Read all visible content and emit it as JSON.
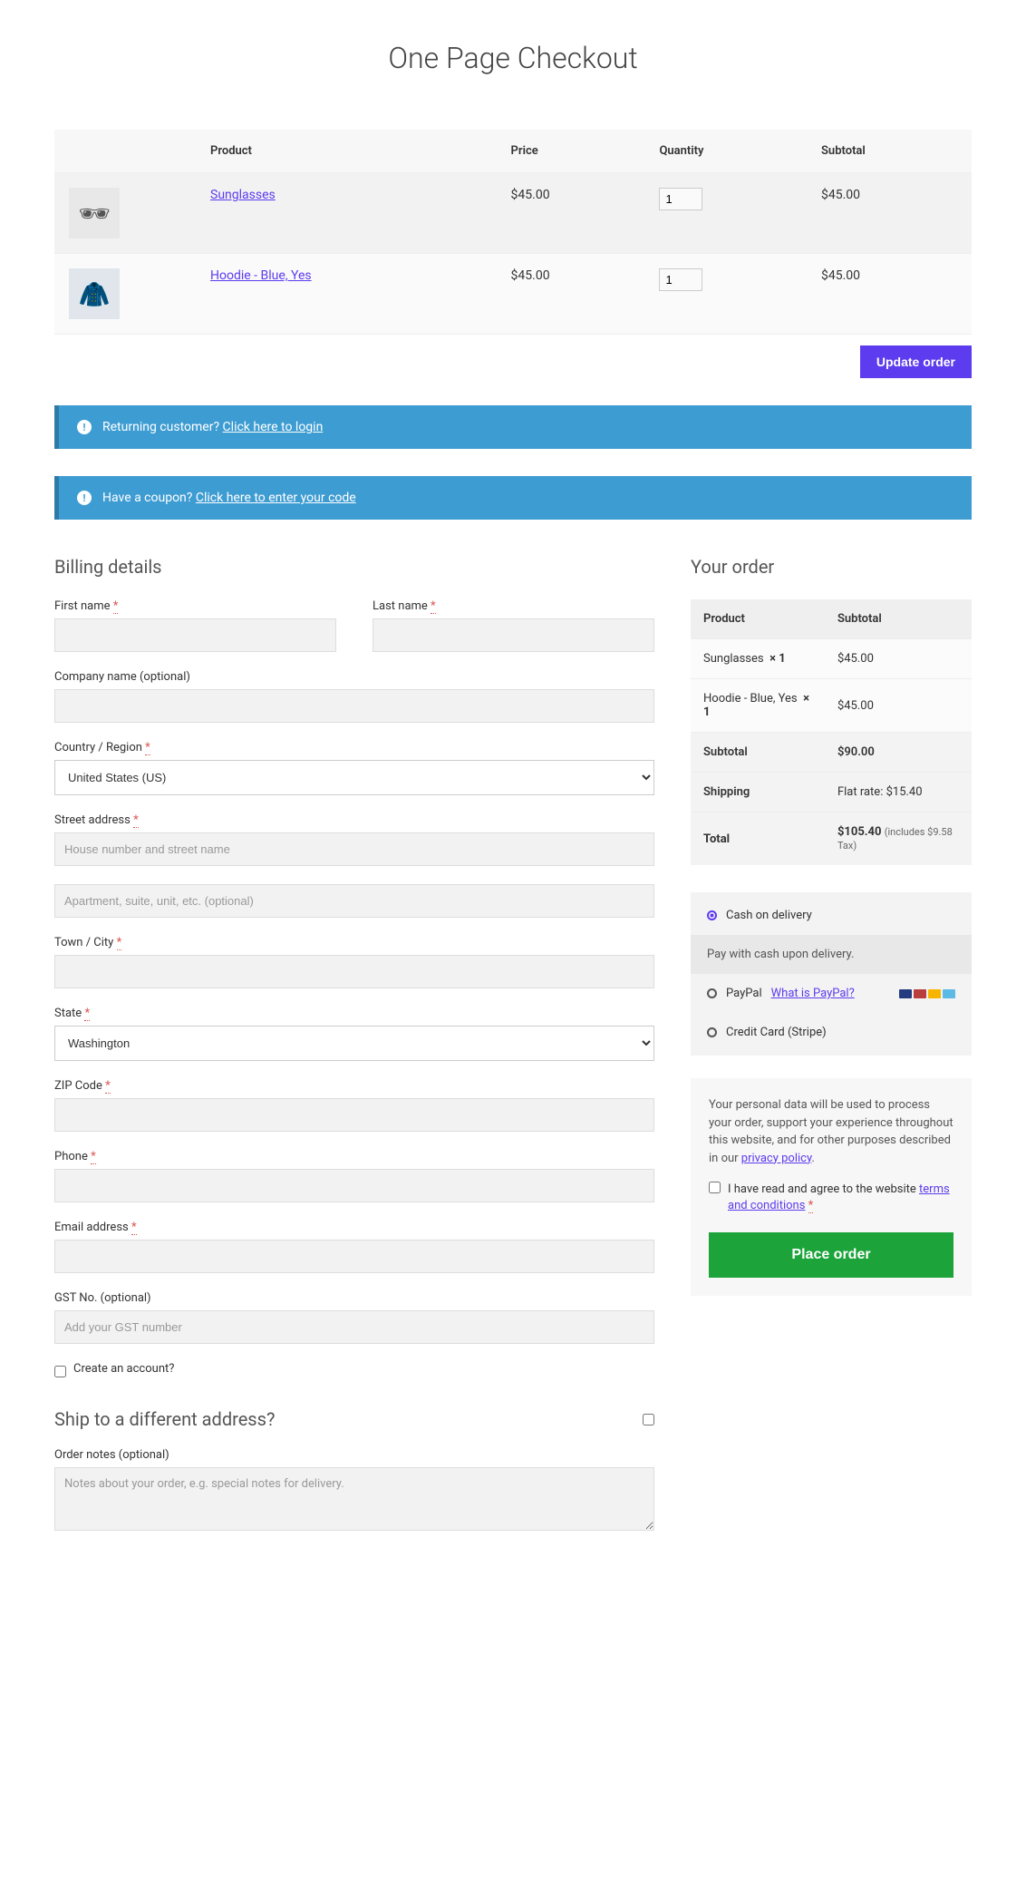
{
  "page_title": "One Page Checkout",
  "cart": {
    "headers": {
      "product": "Product",
      "price": "Price",
      "quantity": "Quantity",
      "subtotal": "Subtotal"
    },
    "rows": [
      {
        "name": "Sunglasses",
        "price": "$45.00",
        "qty": "1",
        "subtotal": "$45.00"
      },
      {
        "name": "Hoodie - Blue, Yes",
        "price": "$45.00",
        "qty": "1",
        "subtotal": "$45.00"
      }
    ],
    "update_btn": "Update order"
  },
  "notices": {
    "returning": {
      "text": "Returning customer?",
      "link": "Click here to login"
    },
    "coupon": {
      "text": "Have a coupon?",
      "link": "Click here to enter your code"
    }
  },
  "billing": {
    "heading": "Billing details",
    "first_name": "First name",
    "last_name": "Last name",
    "company": "Company name (optional)",
    "country": "Country / Region",
    "country_value": "United States (US)",
    "street": "Street address",
    "street_ph": "House number and street name",
    "apt_ph": "Apartment, suite, unit, etc. (optional)",
    "city": "Town / City",
    "state": "State",
    "state_value": "Washington",
    "zip": "ZIP Code",
    "phone": "Phone",
    "email": "Email address",
    "gst": "GST No. (optional)",
    "gst_ph": "Add your GST number",
    "create_account": "Create an account?"
  },
  "shipping": {
    "heading": "Ship to a different address?",
    "notes_label": "Order notes (optional)",
    "notes_ph": "Notes about your order, e.g. special notes for delivery."
  },
  "order": {
    "heading": "Your order",
    "headers": {
      "product": "Product",
      "subtotal": "Subtotal"
    },
    "items": [
      {
        "name": "Sunglasses",
        "qty": "× 1",
        "subtotal": "$45.00"
      },
      {
        "name": "Hoodie - Blue, Yes",
        "qty": "× 1",
        "subtotal": "$45.00"
      }
    ],
    "subtotal_label": "Subtotal",
    "subtotal": "$90.00",
    "shipping_label": "Shipping",
    "shipping": "Flat rate: $15.40",
    "total_label": "Total",
    "total": "$105.40",
    "tax_note": "(includes $9.58 Tax)"
  },
  "payment": {
    "cod": {
      "label": "Cash on delivery",
      "desc": "Pay with cash upon delivery."
    },
    "paypal": {
      "label": "PayPal",
      "what": "What is PayPal?"
    },
    "stripe": {
      "label": "Credit Card (Stripe)"
    }
  },
  "privacy": {
    "text_a": "Your personal data will be used to process your order, support your experience throughout this website, and for other purposes described in our ",
    "link": "privacy policy",
    "terms_a": "I have read and agree to the website ",
    "terms_link": "terms and conditions",
    "place_btn": "Place order"
  }
}
